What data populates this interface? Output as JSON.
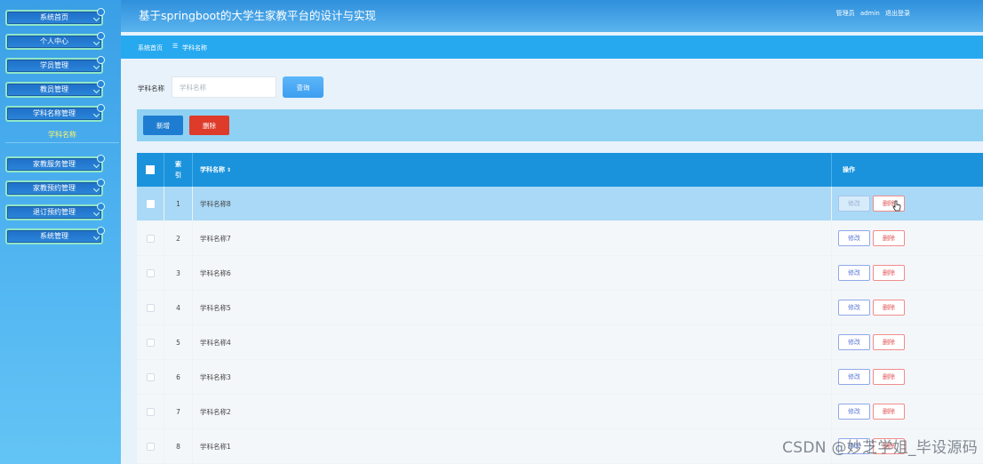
{
  "app": {
    "title": "基于springboot的大学生家教平台的设计与实现",
    "user_role": "管理员",
    "username": "admin",
    "logout": "退出登录"
  },
  "sidebar": {
    "items": [
      {
        "label": "系统首页"
      },
      {
        "label": "个人中心"
      },
      {
        "label": "学员管理"
      },
      {
        "label": "教员管理"
      },
      {
        "label": "学科名称管理"
      },
      {
        "label": "家教服务管理"
      },
      {
        "label": "家教预约管理"
      },
      {
        "label": "退订预约管理"
      },
      {
        "label": "系统管理"
      }
    ],
    "active_sub": "学科名称"
  },
  "breadcrumb": {
    "home": "系统首页",
    "separator": "☰",
    "current": "学科名称"
  },
  "search": {
    "label": "学科名称",
    "placeholder": "学科名称",
    "button": "查询"
  },
  "actions": {
    "add": "新增",
    "delete": "删除"
  },
  "table": {
    "headers": {
      "index": "索引",
      "name": "学科名称",
      "sort_icon": "⇕",
      "ops": "操作"
    },
    "edit_label": "修改",
    "delete_label": "删除",
    "rows": [
      {
        "index": "1",
        "name": "学科名称8",
        "selected": true
      },
      {
        "index": "2",
        "name": "学科名称7"
      },
      {
        "index": "3",
        "name": "学科名称6"
      },
      {
        "index": "4",
        "name": "学科名称5"
      },
      {
        "index": "5",
        "name": "学科名称4"
      },
      {
        "index": "6",
        "name": "学科名称3"
      },
      {
        "index": "7",
        "name": "学科名称2"
      },
      {
        "index": "8",
        "name": "学科名称1"
      }
    ]
  },
  "watermark": "CSDN @妙芝学姐_毕设源码",
  "colors": {
    "sidebar": "#3a9fe6",
    "header": "#1b93dc",
    "add": "#1f7dd1",
    "delete": "#df3b2a"
  }
}
